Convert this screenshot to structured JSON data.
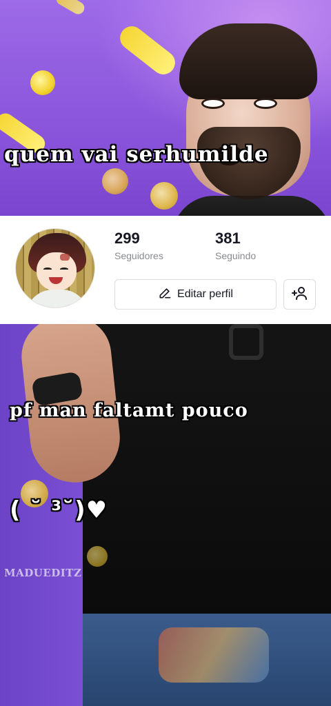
{
  "captions": {
    "top": "quem vai serhumilde",
    "middle": "pf man faltamt pouco",
    "emote": "( ˘ ³˘)♥",
    "watermark": "MADUEDITZ"
  },
  "profile": {
    "followers_count": "299",
    "followers_label": "Seguidores",
    "following_count": "381",
    "following_label": "Seguindo",
    "edit_button_label": "Editar perfil",
    "edit_icon": "pencil-icon",
    "add_friend_icon": "add-user-icon"
  },
  "colors": {
    "background_purple": "#8a55db",
    "confetti_yellow": "#f2d22c",
    "profile_bg": "#ffffff",
    "text_dark": "#161823",
    "text_muted": "#8a8b91"
  }
}
